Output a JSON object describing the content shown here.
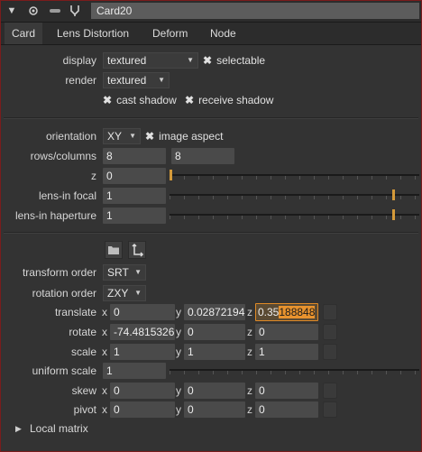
{
  "node_name": "Card20",
  "tabs": [
    "Card",
    "Lens Distortion",
    "Deform",
    "Node"
  ],
  "display": {
    "label": "display",
    "value": "textured",
    "selectable_label": "selectable"
  },
  "render": {
    "label": "render",
    "value": "textured"
  },
  "cast_shadow_label": "cast shadow",
  "receive_shadow_label": "receive shadow",
  "orientation": {
    "label": "orientation",
    "value": "XY",
    "image_aspect_label": "image aspect"
  },
  "rows_columns": {
    "label": "rows/columns",
    "rows": "8",
    "columns": "8"
  },
  "z": {
    "label": "z",
    "value": "0"
  },
  "lens_in_focal": {
    "label": "lens-in focal",
    "value": "1"
  },
  "lens_in_haperture": {
    "label": "lens-in haperture",
    "value": "1"
  },
  "transform_order": {
    "label": "transform order",
    "value": "SRT"
  },
  "rotation_order": {
    "label": "rotation order",
    "value": "ZXY"
  },
  "translate": {
    "label": "translate",
    "x": "0",
    "y": "0.02872194",
    "z_pre": "0.35",
    "z_sel": "188848"
  },
  "rotate": {
    "label": "rotate",
    "x": "-74.4815326",
    "y": "0",
    "z": "0"
  },
  "scale": {
    "label": "scale",
    "x": "1",
    "y": "1",
    "z": "1"
  },
  "uniform_scale": {
    "label": "uniform scale",
    "value": "1"
  },
  "skew": {
    "label": "skew",
    "x": "0",
    "y": "0",
    "z": "0"
  },
  "pivot": {
    "label": "pivot",
    "x": "0",
    "y": "0",
    "z": "0"
  },
  "local_matrix_label": "Local matrix",
  "axis_labels": {
    "x": "x",
    "y": "y",
    "z": "z"
  },
  "icons": [
    "collapse-triangle-icon",
    "visibility-dot-icon",
    "link-icon",
    "properties-icon",
    "folder-icon",
    "move-axis-icon",
    "expand-triangle-icon"
  ],
  "colors": {
    "highlight": "#e8932e",
    "frame": "#7a1c1c",
    "slider_knob": "#d49a3a"
  }
}
